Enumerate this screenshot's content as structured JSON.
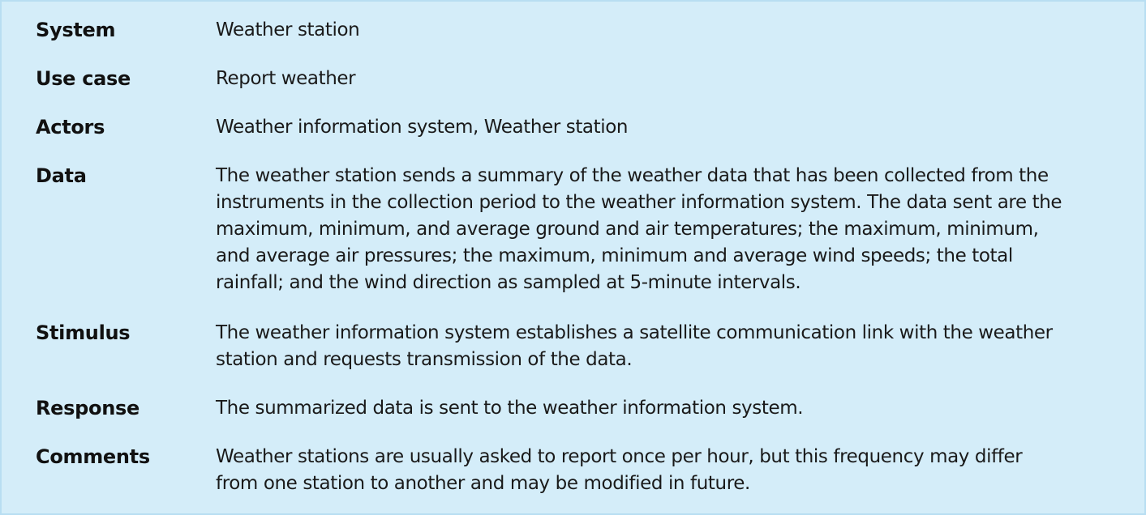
{
  "rows": [
    {
      "label": "System",
      "value": "Weather station"
    },
    {
      "label": "Use case",
      "value": "Report weather"
    },
    {
      "label": "Actors",
      "value": "Weather information system, Weather station"
    },
    {
      "label": "Data",
      "value": "The weather station sends a summary of the weather data that has been collected from the\ninstruments in the collection period to the weather information system. The data sent are the\nmaximum, minimum, and average ground and air temperatures; the maximum, minimum,\nand average air pressures; the maximum, minimum and average wind speeds; the total\nrainfall; and the wind direction as sampled at 5-minute intervals."
    },
    {
      "label": "Stimulus",
      "value": "The weather information system establishes a satellite communication link with the weather\nstation and requests transmission of the data."
    },
    {
      "label": "Response",
      "value": "The summarized data is sent to the weather information system."
    },
    {
      "label": "Comments",
      "value": "Weather stations are usually asked to report once per hour, but this frequency may differ\nfrom one station to another and may be modified in future."
    }
  ]
}
